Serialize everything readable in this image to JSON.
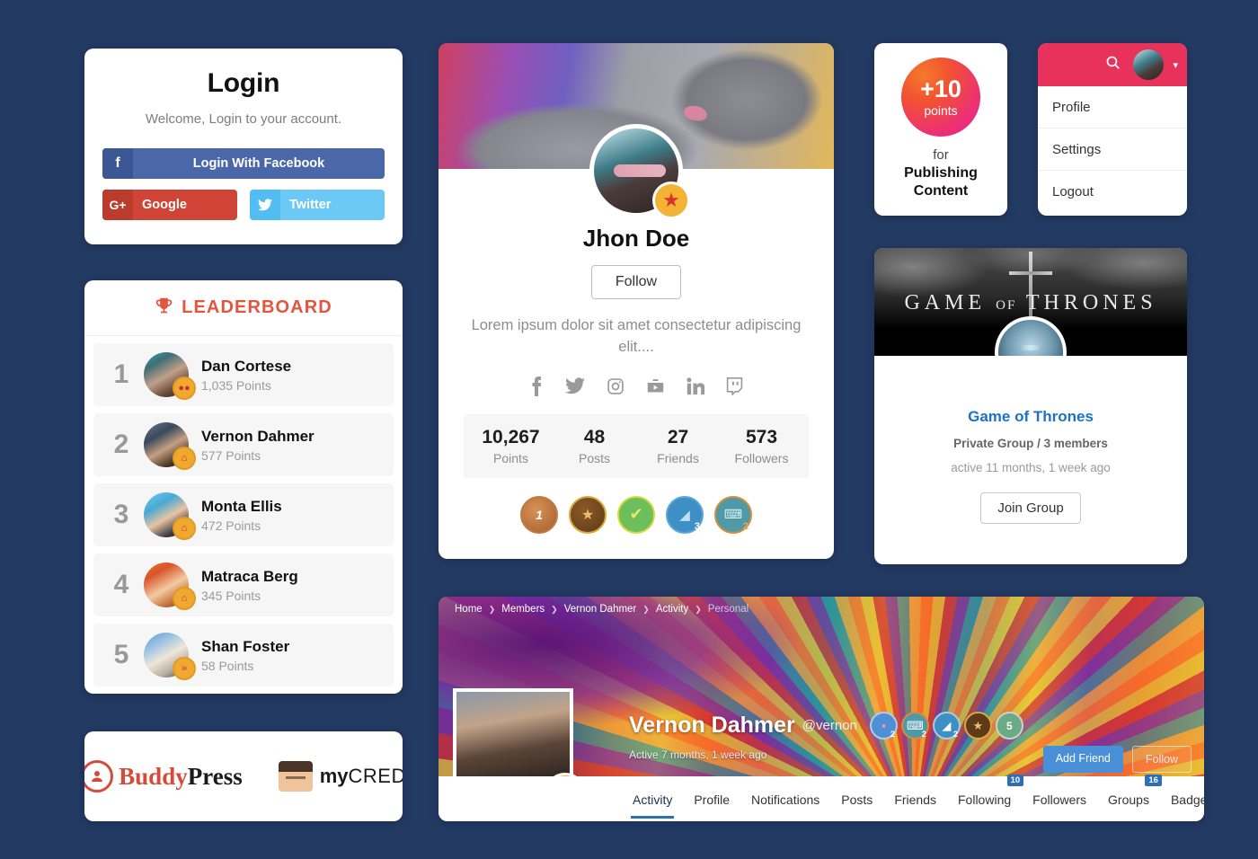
{
  "login": {
    "title": "Login",
    "subtitle": "Welcome, Login to your account.",
    "facebook_label": "Login With Facebook",
    "facebook_icon": "facebook-icon",
    "google_label": "Google",
    "google_icon": "google-plus-icon",
    "twitter_label": "Twitter",
    "twitter_icon": "twitter-icon",
    "facebook_color": "#4a68a8",
    "google_color": "#cf4436",
    "twitter_color": "#6cc9f5"
  },
  "leaderboard": {
    "title": "LEADERBOARD",
    "trophy_icon": "trophy-icon",
    "accent_color": "#e2563f",
    "rows": [
      {
        "rank": "1",
        "name": "Dan Cortese",
        "points": "1,035 Points",
        "badge": "●●"
      },
      {
        "rank": "2",
        "name": "Vernon Dahmer",
        "points": "577 Points",
        "badge": "⌂"
      },
      {
        "rank": "3",
        "name": "Monta Ellis",
        "points": "472 Points",
        "badge": "⌂"
      },
      {
        "rank": "4",
        "name": "Matraca Berg",
        "points": "345 Points",
        "badge": "⌂"
      },
      {
        "rank": "5",
        "name": "Shan Foster",
        "points": "58 Points",
        "badge": "»"
      }
    ]
  },
  "logos": {
    "buddypress_bold": "Buddy",
    "buddypress_rest": "Press",
    "mycred_bold": "my",
    "mycred_rest": "CRED"
  },
  "profile": {
    "name": "Jhon Doe",
    "follow_label": "Follow",
    "bio": "Lorem ipsum dolor sit amet consectetur adipiscing elit....",
    "social": [
      {
        "icon": "facebook-icon",
        "glyph": "f"
      },
      {
        "icon": "twitter-icon",
        "glyph": "🐦"
      },
      {
        "icon": "instagram-icon",
        "glyph": "◎"
      },
      {
        "icon": "youtube-icon",
        "glyph": "▶"
      },
      {
        "icon": "linkedin-icon",
        "glyph": "in"
      },
      {
        "icon": "twitch-icon",
        "glyph": "▢"
      }
    ],
    "stats": [
      {
        "value": "10,267",
        "label": "Points"
      },
      {
        "value": "48",
        "label": "Posts"
      },
      {
        "value": "27",
        "label": "Friends"
      },
      {
        "value": "573",
        "label": "Followers"
      }
    ],
    "badges": [
      {
        "name": "medal-first-place-badge",
        "glyph": "1",
        "color": "#b5703a",
        "count": ""
      },
      {
        "name": "sheriff-star-badge",
        "glyph": "★",
        "color": "#c9931f",
        "count": ""
      },
      {
        "name": "check-verified-badge",
        "glyph": "✔",
        "color": "#6cbf5a",
        "count": ""
      },
      {
        "name": "speech-bubble-badge",
        "glyph": "◢",
        "color": "#3d8fc4",
        "count": "3"
      },
      {
        "name": "keyboard-badge",
        "glyph": "⌨",
        "color": "#4f9aa8",
        "count": "2"
      }
    ],
    "star_badge_icon": "star-badge-icon"
  },
  "points_card": {
    "amount": "+10",
    "unit": "points",
    "for_label": "for",
    "reason": "Publishing Content",
    "gradient_from": "#f57a2c",
    "gradient_to": "#e82a8e"
  },
  "menu_card": {
    "header_color": "#e8315b",
    "search_icon": "search-icon",
    "avatar_icon": "user-avatar",
    "caret_icon": "chevron-down-icon",
    "items": [
      {
        "label": "Profile"
      },
      {
        "label": "Settings"
      },
      {
        "label": "Logout"
      }
    ]
  },
  "group_card": {
    "cover_text_left": "GAME",
    "cover_text_of": "OF",
    "cover_text_right": "THRONES",
    "name": "Game of Thrones",
    "meta": "Private Group / 3 members",
    "active": "active 11 months, 1 week ago",
    "join_label": "Join Group",
    "name_color": "#1b72c6"
  },
  "banner": {
    "breadcrumb": [
      "Home",
      "Members",
      "Vernon Dahmer",
      "Activity",
      "Personal"
    ],
    "name": "Vernon Dahmer",
    "handle": "@vernon",
    "active": "Active 7 months, 1 week ago",
    "add_friend_label": "Add Friend",
    "follow_label": "Follow",
    "avatar_badge_glyph": "★★",
    "badges": [
      {
        "name": "comment-badge",
        "glyph": "▤",
        "color": "#4f8fd4",
        "count": "2"
      },
      {
        "name": "keyboard-badge",
        "glyph": "⌨",
        "color": "#4f9aa8",
        "count": "2"
      },
      {
        "name": "speech-bubble-badge",
        "glyph": "◢",
        "color": "#3d8fc4",
        "count": "2"
      },
      {
        "name": "sheriff-star-badge",
        "glyph": "★",
        "color": "#c9931f",
        "count": ""
      },
      {
        "name": "medal-fifth-badge",
        "glyph": "5",
        "color": "#6aab84",
        "count": ""
      }
    ],
    "tabs": [
      {
        "label": "Activity",
        "count": "",
        "active": true
      },
      {
        "label": "Profile",
        "count": "",
        "active": false
      },
      {
        "label": "Notifications",
        "count": "",
        "active": false
      },
      {
        "label": "Posts",
        "count": "",
        "active": false
      },
      {
        "label": "Friends",
        "count": "",
        "active": false
      },
      {
        "label": "Following",
        "count": "10",
        "active": false
      },
      {
        "label": "Followers",
        "count": "",
        "active": false
      },
      {
        "label": "Groups",
        "count": "16",
        "active": false
      },
      {
        "label": "Badges",
        "count": "",
        "active": false
      }
    ],
    "more_glyph": "•••",
    "accent_color": "#2f6fb5"
  },
  "theme": {
    "background": "#233a63"
  }
}
